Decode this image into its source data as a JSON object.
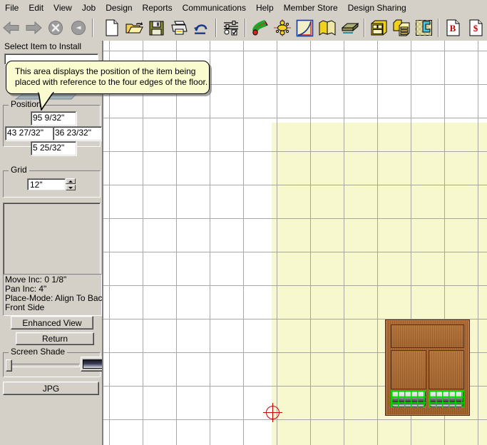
{
  "menubar": {
    "items": [
      {
        "label": "File",
        "name": "menu-file"
      },
      {
        "label": "Edit",
        "name": "menu-edit"
      },
      {
        "label": "View",
        "name": "menu-view"
      },
      {
        "label": "Job",
        "name": "menu-job"
      },
      {
        "label": "Design",
        "name": "menu-design"
      },
      {
        "label": "Reports",
        "name": "menu-reports"
      },
      {
        "label": "Communications",
        "name": "menu-communications"
      },
      {
        "label": "Help",
        "name": "menu-help"
      },
      {
        "label": "Member Store",
        "name": "menu-member-store"
      },
      {
        "label": "Design Sharing",
        "name": "menu-design-sharing"
      }
    ]
  },
  "toolbar": {
    "icons": [
      {
        "name": "back-arrow-icon",
        "title": "Back"
      },
      {
        "name": "forward-arrow-icon",
        "title": "Forward"
      },
      {
        "name": "stop-icon",
        "title": "Stop"
      },
      {
        "name": "refresh-icon",
        "title": "Refresh"
      },
      {
        "name": "new-document-icon",
        "title": "New"
      },
      {
        "name": "open-folder-icon",
        "title": "Open"
      },
      {
        "name": "save-disk-icon",
        "title": "Save"
      },
      {
        "name": "print-icon",
        "title": "Print"
      },
      {
        "name": "undo-icon",
        "title": "Undo"
      },
      {
        "name": "settings-sliders-icon",
        "title": "Options"
      },
      {
        "name": "paint-roller-icon",
        "title": "Color"
      },
      {
        "name": "light-fixture-icon",
        "title": "Lighting"
      },
      {
        "name": "curve-chart-icon",
        "title": "Elevation"
      },
      {
        "name": "books-icon",
        "title": "Catalog"
      },
      {
        "name": "countertop-icon",
        "title": "Countertop"
      },
      {
        "name": "cabinet-3d-icon",
        "title": "Cabinet"
      },
      {
        "name": "cabinet-stack-icon",
        "title": "Cabinet Stack"
      },
      {
        "name": "floorplan-icon",
        "title": "Floor Plan"
      },
      {
        "name": "bid-document-icon",
        "title": "Bid",
        "glyph": "B"
      },
      {
        "name": "price-document-icon",
        "title": "Price",
        "glyph": "$"
      }
    ]
  },
  "sidebar": {
    "select_item_label": "Select Item to Install",
    "select_item_value": "",
    "position": {
      "group_title": "Position",
      "top": "95 9/32\"",
      "left": "43 27/32\"",
      "right": "36 23/32\"",
      "bottom": "5 25/32\""
    },
    "grid": {
      "group_title": "Grid",
      "value": "12\""
    },
    "status": {
      "lines": [
        "Move Inc: 0 1/8\"",
        "Pan Inc: 4\"",
        "Place-Mode: Align To Back",
        "Front Side"
      ]
    },
    "buttons": {
      "enhanced_view": "Enhanced View",
      "return": "Return",
      "jpg": "JPG"
    },
    "screen_shade": {
      "group_title": "Screen Shade",
      "value": 0
    }
  },
  "tooltip": {
    "line1": "This area displays the position of the item being",
    "line2": "placed with reference to the four edges of the floor."
  },
  "canvas": {
    "grid_spacing_px": 47,
    "floor_color": "#f8f8cf",
    "grid_color": "#9a9a9a",
    "crosshair_color": "#d00000",
    "selection_color": "#00d400",
    "cabinet_name": "base-cabinet-item"
  }
}
